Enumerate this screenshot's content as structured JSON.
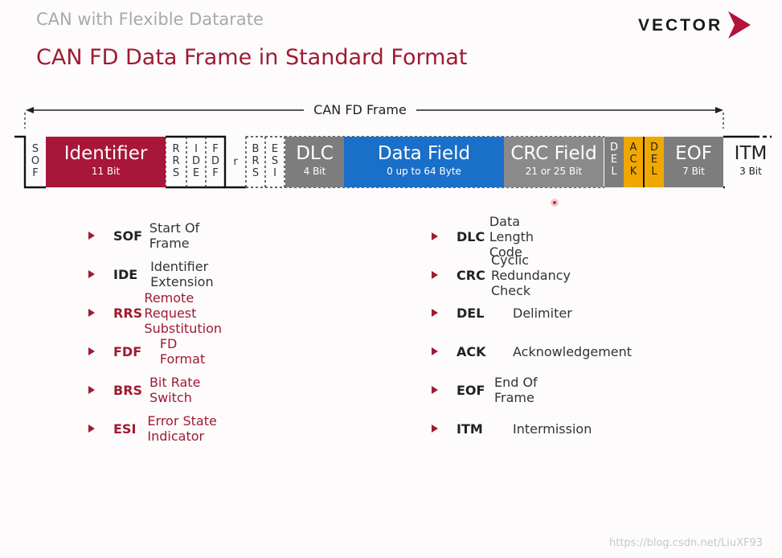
{
  "header": {
    "subtitle": "CAN with Flexible Datarate",
    "title": "CAN FD Data Frame in Standard Format",
    "logo_text": "VECTOR"
  },
  "frame": {
    "label": "CAN FD Frame",
    "fields": {
      "sof": [
        "S",
        "O",
        "F"
      ],
      "identifier": {
        "name": "Identifier",
        "size": "11 Bit"
      },
      "rrs": [
        "R",
        "R",
        "S"
      ],
      "ide": [
        "I",
        "D",
        "E"
      ],
      "fdf": [
        "F",
        "D",
        "F"
      ],
      "r": "r",
      "brs": [
        "B",
        "R",
        "S"
      ],
      "esi": [
        "E",
        "S",
        "I"
      ],
      "dlc": {
        "name": "DLC",
        "size": "4 Bit"
      },
      "data": {
        "name": "Data Field",
        "size": "0 up to 64 Byte"
      },
      "crc": {
        "name": "CRC Field",
        "size": "21 or 25 Bit"
      },
      "del1": [
        "D",
        "E",
        "L"
      ],
      "ack": [
        "A",
        "C",
        "K"
      ],
      "del2": [
        "D",
        "E",
        "L"
      ],
      "eof": {
        "name": "EOF",
        "size": "7 Bit"
      },
      "itm": {
        "name": "ITM",
        "size": "3 Bit"
      }
    },
    "colors": {
      "identifier": "#a8163a",
      "dlc": "#808080",
      "data": "#1a6fc8",
      "crc": "#8a8a8a",
      "del": "#808080",
      "ack": "#f0a800",
      "eof": "#808080"
    }
  },
  "legend": {
    "left": [
      {
        "abbr": "SOF",
        "desc": "Start Of Frame",
        "highlight": false
      },
      {
        "abbr": "IDE",
        "desc": "Identifier Extension",
        "highlight": false
      },
      {
        "abbr": "RRS",
        "desc": "Remote Request Substitution",
        "highlight": true
      },
      {
        "abbr": "FDF",
        "desc": "FD Format",
        "highlight": true
      },
      {
        "abbr": "BRS",
        "desc": "Bit Rate Switch",
        "highlight": true
      },
      {
        "abbr": "ESI",
        "desc": "Error State Indicator",
        "highlight": true
      }
    ],
    "right": [
      {
        "abbr": "DLC",
        "desc": "Data Length Code",
        "highlight": false
      },
      {
        "abbr": "CRC",
        "desc": "Cyclic Redundancy Check",
        "highlight": false
      },
      {
        "abbr": "DEL",
        "desc": "Delimiter",
        "highlight": false
      },
      {
        "abbr": "ACK",
        "desc": "Acknowledgement",
        "highlight": false
      },
      {
        "abbr": "EOF",
        "desc": "End Of Frame",
        "highlight": false
      },
      {
        "abbr": "ITM",
        "desc": "Intermission",
        "highlight": false
      }
    ]
  },
  "watermark": "https://blog.csdn.net/LiuXF93"
}
